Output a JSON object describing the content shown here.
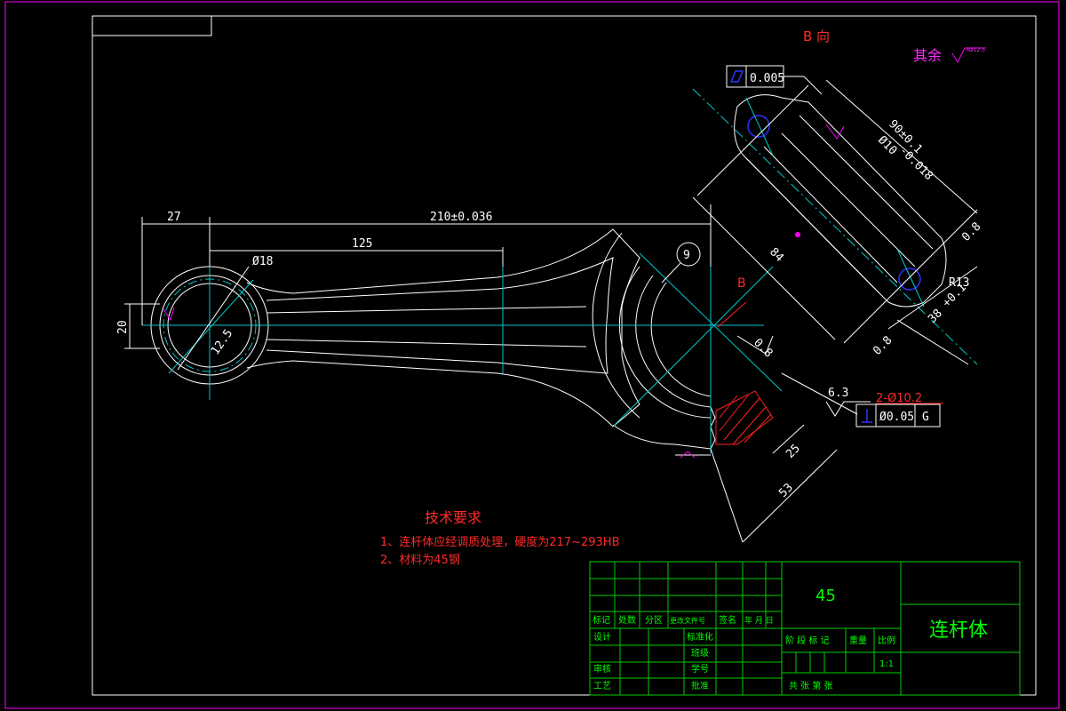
{
  "drawing": {
    "view_label": "B 向",
    "section_label": "B",
    "surface_note": "其余",
    "surface_symbol_value": "Ra12.5",
    "dims": {
      "d27": "27",
      "d210": "210±0.036",
      "d125": "125",
      "dia18": "Ø18",
      "d20": "20",
      "r12_5": "12.5",
      "tol_flat": "0.005",
      "d90": "90±0.1",
      "dia10": "Ø10",
      "dia10_tol": "-0.018",
      "d84": "84",
      "r13": "R13",
      "d0_8a": "0.8",
      "d0_8b": "0.8",
      "d0_8c": "0.8",
      "d38": "38",
      "d38_tol": "+0.1",
      "circ_mark": "9",
      "rough_6_3": "6.3",
      "hole_note": "2-Ø10.2",
      "perp_value": "Ø0.05",
      "perp_datum": "G",
      "d25": "25",
      "d53": "53"
    },
    "tech_req": {
      "title": "技术要求",
      "line1": "1、连杆体应经调质处理，硬度为217~293HB",
      "line2": "2、材料为45钢"
    }
  },
  "title_block": {
    "material": "45",
    "part_name": "连杆体",
    "h_mark": "标记",
    "h_count": "处数",
    "h_zone": "分区",
    "h_docno": "更改文件号",
    "h_sign": "签名",
    "h_date": "年 月 日",
    "design": "设计",
    "standard": "标准化",
    "class": "班级",
    "review": "审核",
    "student_no": "学号",
    "process": "工艺",
    "approve": "批准",
    "stage_mark": "阶 段 标 记",
    "weight": "重量",
    "scale_label": "比例",
    "scale": "1:1",
    "sheets": "共    张  第    张"
  },
  "colors": {
    "frame": "#ff00ff",
    "line": "#ffffff",
    "center": "#00c8c8",
    "table": "#00cc00",
    "text_red": "#ff2a2a",
    "text_green": "#00ff00"
  }
}
